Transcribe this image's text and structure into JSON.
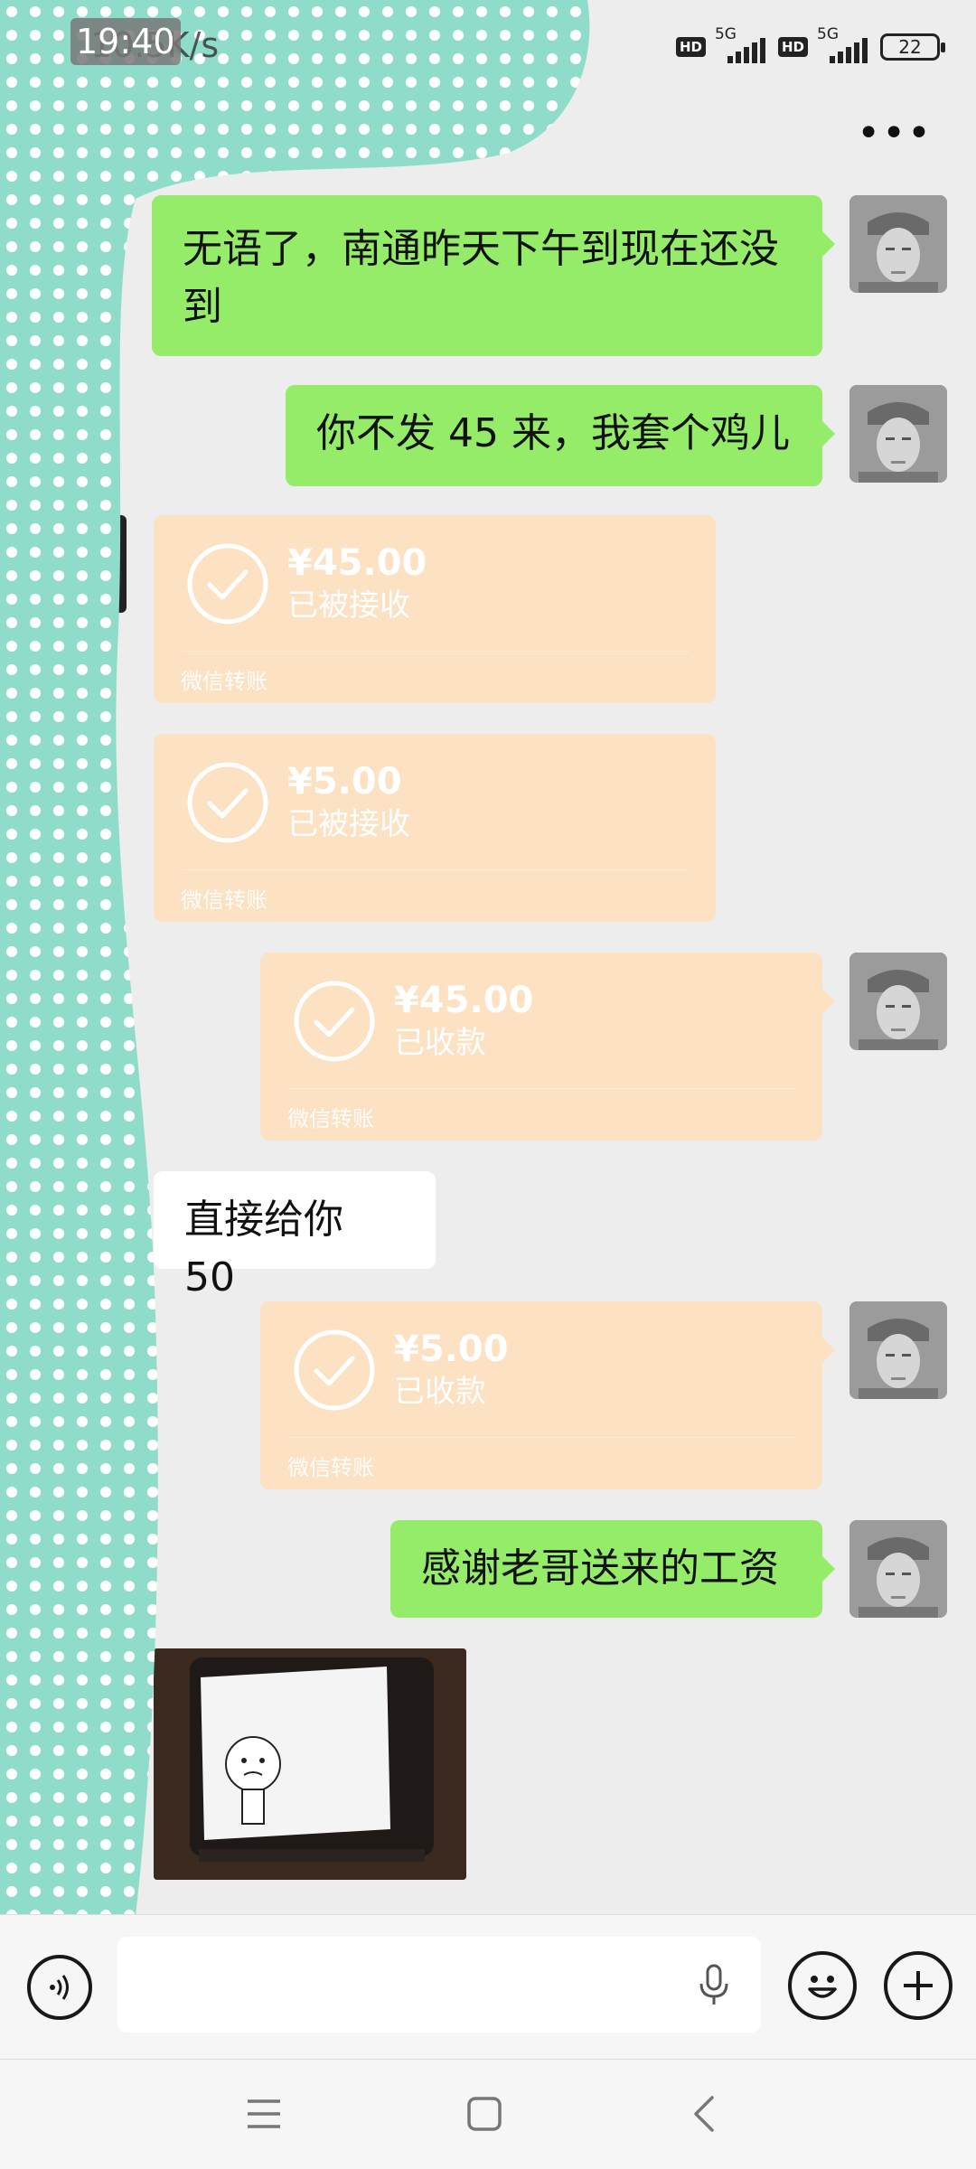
{
  "status_bar": {
    "time": "19:40",
    "net_speed": "10.5K/s",
    "hd_label": "HD",
    "network_label": "5G",
    "battery": "22"
  },
  "header": {
    "more_label": "•••"
  },
  "messages": {
    "m1": "无语了，南通昨天下午到现在还没到",
    "m2": "你不发 45 来，我套个鸡儿",
    "t1": {
      "amount": "¥45.00",
      "status": "已被接收",
      "footer": "微信转账"
    },
    "t2": {
      "amount": "¥5.00",
      "status": "已被接收",
      "footer": "微信转账"
    },
    "t3": {
      "amount": "¥45.00",
      "status": "已收款",
      "footer": "微信转账"
    },
    "m3": "直接给你 50",
    "t4": {
      "amount": "¥5.00",
      "status": "已收款",
      "footer": "微信转账"
    },
    "m4": "感谢老哥送来的工资"
  },
  "colors": {
    "my_bubble": "#95ec69",
    "other_bubble": "#ffffff",
    "transfer_bubble": "#fde1c3",
    "chat_bg": "#ededed",
    "polka": "#8fdccb"
  },
  "input_bar": {
    "voice_icon": "voice-icon",
    "mic_icon": "microphone-icon",
    "emoji_icon": "emoji-icon",
    "plus_icon": "plus-icon"
  },
  "nav_bar": {
    "menu_icon": "menu-icon",
    "home_icon": "home-icon",
    "back_icon": "back-icon"
  }
}
